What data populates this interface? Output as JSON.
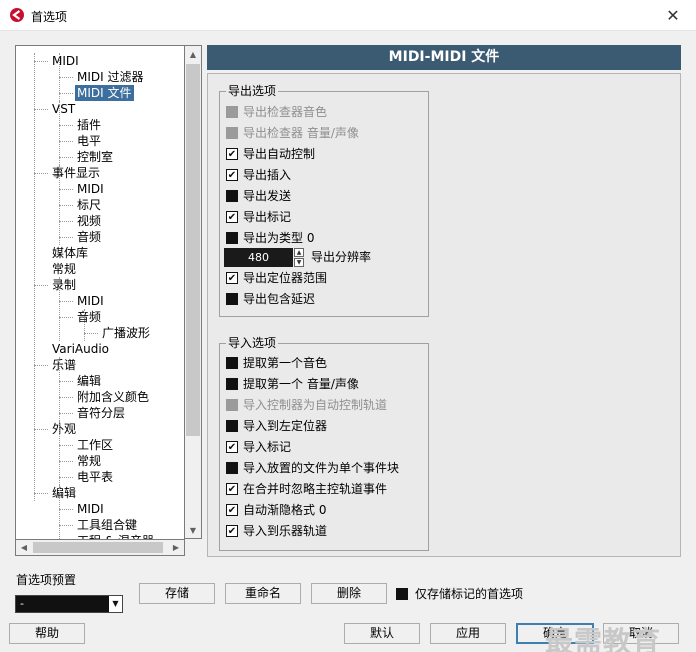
{
  "window": {
    "title": "首选项",
    "close_glyph": "✕"
  },
  "tree": {
    "items": [
      {
        "label": "MIDI",
        "level": 1,
        "selected": false,
        "connector": true
      },
      {
        "label": "MIDI 过滤器",
        "level": 2,
        "selected": false,
        "connector": true
      },
      {
        "label": "MIDI 文件",
        "level": 2,
        "selected": true,
        "connector": true
      },
      {
        "label": "VST",
        "level": 1,
        "selected": false,
        "connector": true
      },
      {
        "label": "插件",
        "level": 2,
        "selected": false,
        "connector": true
      },
      {
        "label": "电平",
        "level": 2,
        "selected": false,
        "connector": true
      },
      {
        "label": "控制室",
        "level": 2,
        "selected": false,
        "connector": true
      },
      {
        "label": "事件显示",
        "level": 1,
        "selected": false,
        "connector": true
      },
      {
        "label": "MIDI",
        "level": 2,
        "selected": false,
        "connector": true
      },
      {
        "label": "标尺",
        "level": 2,
        "selected": false,
        "connector": true
      },
      {
        "label": "视频",
        "level": 2,
        "selected": false,
        "connector": true
      },
      {
        "label": "音频",
        "level": 2,
        "selected": false,
        "connector": true
      },
      {
        "label": "媒体库",
        "level": 1,
        "selected": false,
        "connector": false
      },
      {
        "label": "常规",
        "level": 1,
        "selected": false,
        "connector": false
      },
      {
        "label": "录制",
        "level": 1,
        "selected": false,
        "connector": true
      },
      {
        "label": "MIDI",
        "level": 2,
        "selected": false,
        "connector": true
      },
      {
        "label": "音频",
        "level": 2,
        "selected": false,
        "connector": true
      },
      {
        "label": "广播波形",
        "level": 3,
        "selected": false,
        "connector": true
      },
      {
        "label": "VariAudio",
        "level": 1,
        "selected": false,
        "connector": false
      },
      {
        "label": "乐谱",
        "level": 1,
        "selected": false,
        "connector": true
      },
      {
        "label": "编辑",
        "level": 2,
        "selected": false,
        "connector": true
      },
      {
        "label": "附加含义颜色",
        "level": 2,
        "selected": false,
        "connector": true
      },
      {
        "label": "音符分层",
        "level": 2,
        "selected": false,
        "connector": true
      },
      {
        "label": "外观",
        "level": 1,
        "selected": false,
        "connector": true
      },
      {
        "label": "工作区",
        "level": 2,
        "selected": false,
        "connector": true
      },
      {
        "label": "常规",
        "level": 2,
        "selected": false,
        "connector": true
      },
      {
        "label": "电平表",
        "level": 2,
        "selected": false,
        "connector": true
      },
      {
        "label": "编辑",
        "level": 1,
        "selected": false,
        "connector": true
      },
      {
        "label": "MIDI",
        "level": 2,
        "selected": false,
        "connector": true
      },
      {
        "label": "工具组合键",
        "level": 2,
        "selected": false,
        "connector": true
      },
      {
        "label": "工程 & 混音器",
        "level": 2,
        "selected": false,
        "connector": true
      }
    ]
  },
  "panel": {
    "title": "MIDI-MIDI 文件",
    "export_group": {
      "title": "导出选项",
      "options": [
        {
          "label": "导出检查器音色",
          "checked": false,
          "disabled": true
        },
        {
          "label": "导出检查器 音量/声像",
          "checked": false,
          "disabled": true
        },
        {
          "label": "导出自动控制",
          "checked": true,
          "disabled": false
        },
        {
          "label": "导出插入",
          "checked": true,
          "disabled": false
        },
        {
          "label": "导出发送",
          "checked": false,
          "disabled": false
        },
        {
          "label": "导出标记",
          "checked": true,
          "disabled": false
        },
        {
          "label": "导出为类型 0",
          "checked": false,
          "disabled": false
        }
      ],
      "resolution": {
        "value": "480",
        "label": "导出分辨率"
      },
      "options_after": [
        {
          "label": "导出定位器范围",
          "checked": true,
          "disabled": false
        },
        {
          "label": "导出包含延迟",
          "checked": false,
          "disabled": false
        }
      ]
    },
    "import_group": {
      "title": "导入选项",
      "options": [
        {
          "label": "提取第一个音色",
          "checked": false,
          "disabled": false
        },
        {
          "label": "提取第一个 音量/声像",
          "checked": false,
          "disabled": false
        },
        {
          "label": "导入控制器为自动控制轨道",
          "checked": false,
          "disabled": true
        },
        {
          "label": "导入到左定位器",
          "checked": false,
          "disabled": false
        },
        {
          "label": "导入标记",
          "checked": true,
          "disabled": false
        },
        {
          "label": "导入放置的文件为单个事件块",
          "checked": false,
          "disabled": false
        },
        {
          "label": "在合并时忽略主控轨道事件",
          "checked": true,
          "disabled": false
        },
        {
          "label": "自动渐隐格式 0",
          "checked": true,
          "disabled": false
        },
        {
          "label": "导入到乐器轨道",
          "checked": true,
          "disabled": false
        }
      ]
    }
  },
  "presets": {
    "label": "首选项预置",
    "selected": "-",
    "store_label": "存储",
    "rename_label": "重命名",
    "delete_label": "删除",
    "only_marked_label": "仅存储标记的首选项",
    "only_marked_checked": false
  },
  "footer": {
    "help_label": "帮助",
    "default_label": "默认",
    "apply_label": "应用",
    "ok_label": "确定",
    "cancel_label": "取消"
  },
  "watermark": "最需教育",
  "icons": {
    "check": "✔",
    "up": "▲",
    "down": "▼",
    "left": "◀",
    "right": "▶",
    "dropdown": "▼"
  }
}
